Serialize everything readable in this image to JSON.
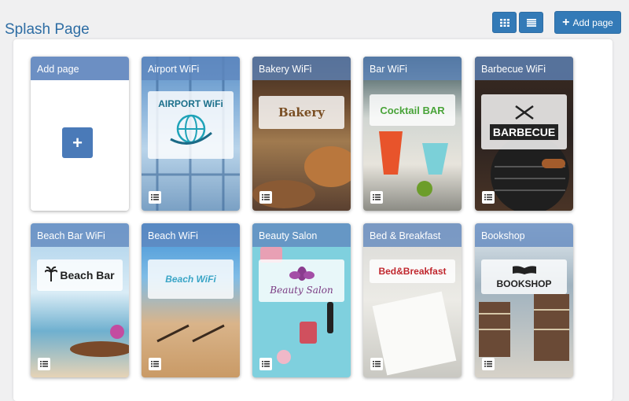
{
  "header": {
    "title": "Splash Page",
    "grid_view_icon": "grid-icon",
    "list_view_icon": "list-icon",
    "add_page_label": "Add page"
  },
  "add_card": {
    "title": "Add page",
    "icon": "plus-icon"
  },
  "cards": [
    {
      "title": "Airport WiFi",
      "logo_text": "AIRPORT WiFi"
    },
    {
      "title": "Bakery WiFi",
      "logo_text": "Bakery"
    },
    {
      "title": "Bar WiFi",
      "logo_text": "Cocktail BAR"
    },
    {
      "title": "Barbecue WiFi",
      "logo_text": "BARBECUE"
    },
    {
      "title": "Beach Bar WiFi",
      "logo_text": "Beach Bar"
    },
    {
      "title": "Beach WiFi",
      "logo_text": "Beach WiFi"
    },
    {
      "title": "Beauty Salon",
      "logo_text": "Beauty Salon"
    },
    {
      "title": "Bed & Breakfast",
      "logo_text": "Bed&Breakfast"
    },
    {
      "title": "Bookshop",
      "logo_text": "BOOKSHOP"
    }
  ],
  "colors": {
    "primary": "#337ab7",
    "title_bar": "#5f87be",
    "heading": "#2e6da4"
  }
}
